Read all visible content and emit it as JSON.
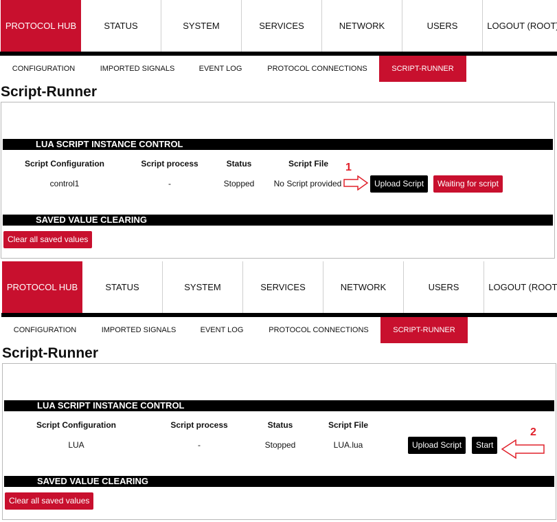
{
  "nav": {
    "items": [
      "PROTOCOL HUB",
      "STATUS",
      "SYSTEM",
      "SERVICES",
      "NETWORK",
      "USERS",
      "LOGOUT (ROOT)"
    ],
    "active_index": 0
  },
  "subnav": {
    "items": [
      "CONFIGURATION",
      "IMPORTED SIGNALS",
      "EVENT LOG",
      "PROTOCOL CONNECTIONS",
      "SCRIPT-RUNNER"
    ],
    "active_index": 4
  },
  "colors": {
    "accent": "#c8102e",
    "bar": "#000000",
    "annotation": "#e0202a"
  },
  "screen1": {
    "page_title": "Script-Runner",
    "lua_section_title": "LUA SCRIPT INSTANCE CONTROL",
    "table_headers": [
      "Script Configuration",
      "Script process",
      "Status",
      "Script File"
    ],
    "row": {
      "configuration": "control1",
      "process": "-",
      "status": "Stopped",
      "file": "No Script provided"
    },
    "upload_button": "Upload Script",
    "action_button": "Waiting for script",
    "saved_section_title": "SAVED VALUE CLEARING",
    "clear_button": "Clear all saved values",
    "annotation_number": "1"
  },
  "screen2": {
    "page_title": "Script-Runner",
    "lua_section_title": "LUA SCRIPT INSTANCE CONTROL",
    "table_headers": [
      "Script Configuration",
      "Script process",
      "Status",
      "Script File"
    ],
    "row": {
      "configuration": "LUA",
      "process": "-",
      "status": "Stopped",
      "file": "LUA.lua"
    },
    "upload_button": "Upload Script",
    "action_button": "Start",
    "saved_section_title": "SAVED VALUE CLEARING",
    "clear_button": "Clear all saved values",
    "annotation_number": "2"
  }
}
